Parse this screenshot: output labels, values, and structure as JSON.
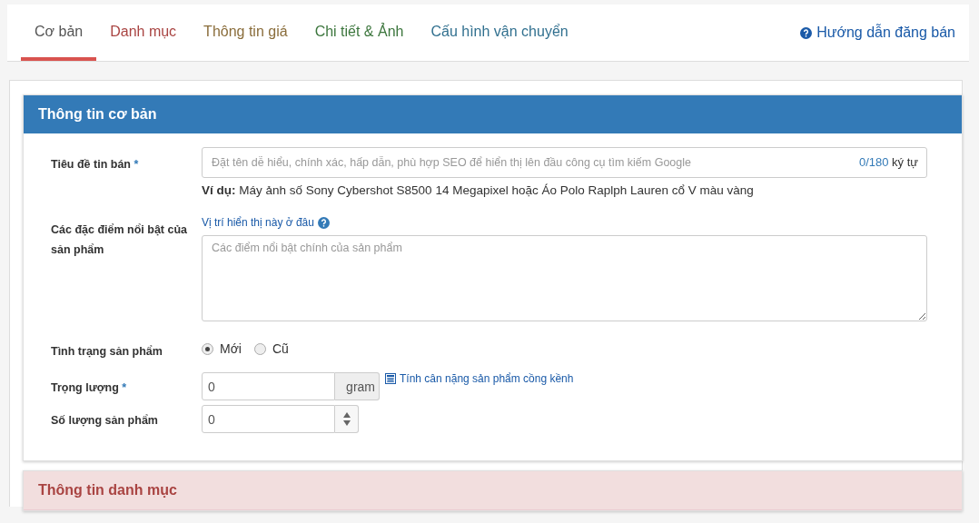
{
  "tabs": [
    {
      "label": "Cơ bản",
      "color": "#555555",
      "selected": true
    },
    {
      "label": "Danh mục",
      "color": "#a94442",
      "selected": false
    },
    {
      "label": "Thông tin giá",
      "color": "#8a6d3b",
      "selected": false
    },
    {
      "label": "Chi tiết & Ảnh",
      "color": "#3c763d",
      "selected": false
    },
    {
      "label": "Cấu hình vận chuyển",
      "color": "#31708f",
      "selected": false
    }
  ],
  "help_link": "Hướng dẫn đăng bán",
  "panels": [
    {
      "title": "Thông tin cơ bản",
      "kind": "primary",
      "fields": [
        {
          "kind": "text",
          "label": "Tiêu đề tin bán",
          "required_mark": "*",
          "placeholder": "Đặt tên dễ hiểu, chính xác, hấp dẫn, phù hợp SEO để hiển thị lên đầu công cụ tìm kiếm Google",
          "counter": "0/180",
          "counter_unit": "ký tự",
          "example": "**Ví dụ:** Máy ảnh số Sony Cybershot S8500 14 Megapixel hoặc Áo Polo Raplph Lauren cổ V màu vàng"
        },
        {
          "kind": "textarea",
          "label": "Các đặc điểm nổi bật của sản phẩm",
          "link": "Vị trí hiển thị này ở đâu",
          "placeholder": "Các điểm nổi bật chính của sản phẩm"
        },
        {
          "kind": "radio",
          "label": "Tình trạng sản phẩm",
          "options": [
            {
              "label": "Mới",
              "selected": true
            },
            {
              "label": "Cũ",
              "selected": false
            }
          ]
        },
        {
          "kind": "addon",
          "label": "Trọng lượng",
          "required_mark": "*",
          "value": "0",
          "addon": "gram",
          "link": "Tính cân nặng sản phẩm cồng kềnh"
        },
        {
          "kind": "spinner",
          "label": "Số lượng sản phẩm",
          "value": "0"
        }
      ]
    },
    {
      "title": "Thông tin danh mục",
      "kind": "danger"
    }
  ]
}
